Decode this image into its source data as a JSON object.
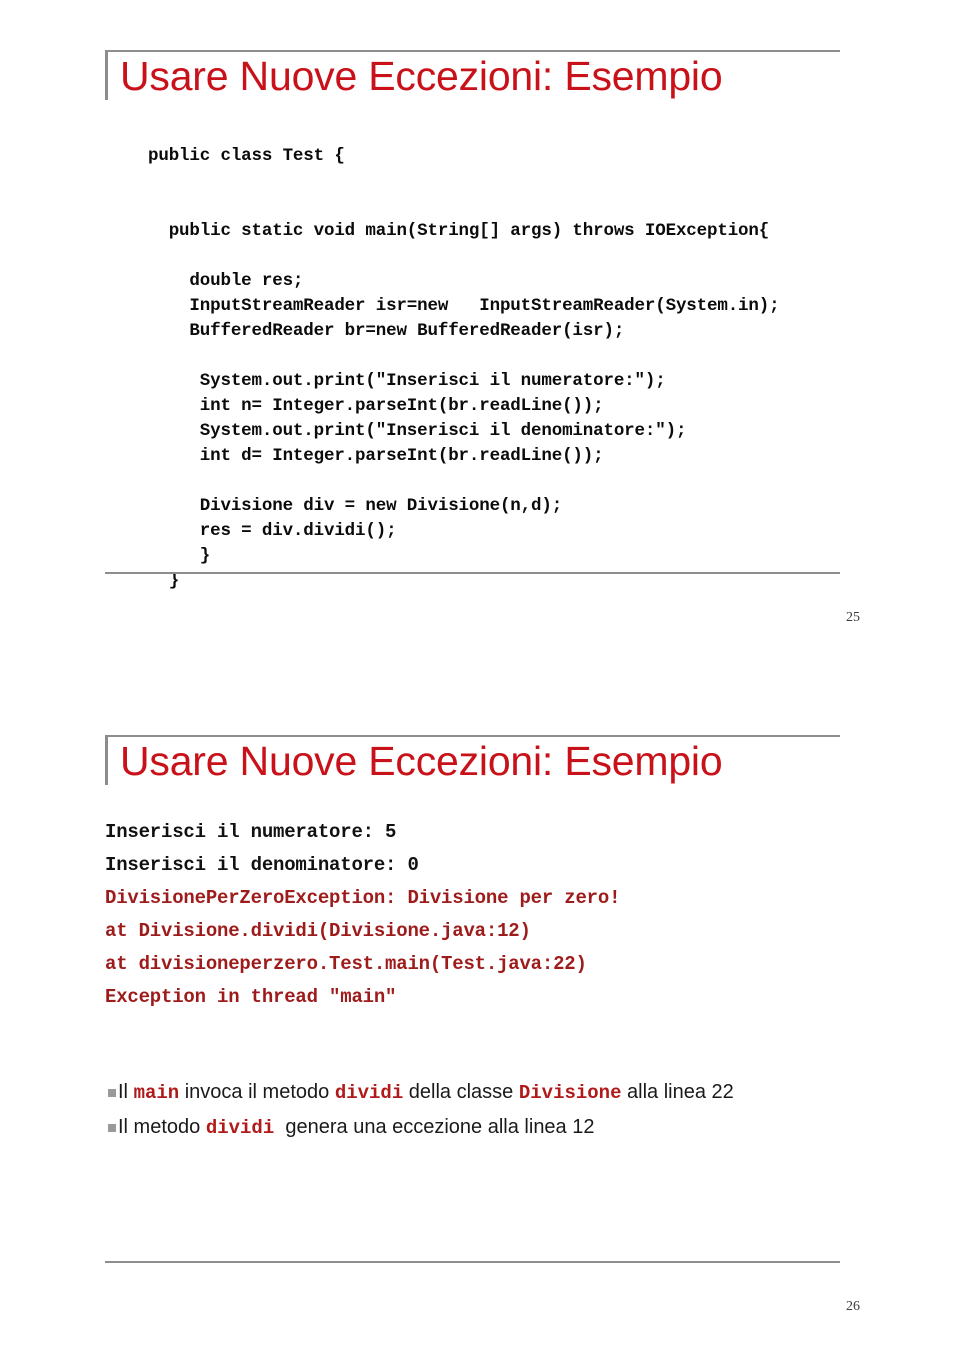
{
  "document": {
    "type": "lecture-slides-handout",
    "page_count_visible": 2
  },
  "colors": {
    "title_red": "#c9111a",
    "exception_red": "#9e1b1b",
    "inline_code_red": "#b01a1a",
    "rule_gray": "#8d8d8d",
    "bullet_gray": "#9a9a9a",
    "code_black": "#0b0b0b"
  },
  "slide1": {
    "title": "Usare Nuove Eccezioni: Esempio",
    "page_number": "25",
    "code_lines": [
      "public class Test {",
      "",
      "",
      "  public static void main(String[] args) throws IOException{",
      "",
      "    double res;",
      "    InputStreamReader isr=new   InputStreamReader(System.in);",
      "    BufferedReader br=new BufferedReader(isr);",
      "",
      "     System.out.print(\"Inserisci il numeratore:\");",
      "     int n= Integer.parseInt(br.readLine());",
      "     System.out.print(\"Inserisci il denominatore:\");",
      "     int d= Integer.parseInt(br.readLine());",
      "",
      "     Divisione div = new Divisione(n,d);",
      "     res = div.dividi();",
      "     }",
      "  }"
    ]
  },
  "slide2": {
    "title": "Usare Nuove Eccezioni: Esempio",
    "page_number": "26",
    "console_lines": [
      {
        "text": "Inserisci il numeratore: 5",
        "style": "io"
      },
      {
        "text": "Inserisci il denominatore: 0",
        "style": "io"
      },
      {
        "text": "DivisionePerZeroException: Divisione per zero!",
        "style": "exc"
      },
      {
        "text": "at Divisione.dividi(Divisione.java:12)",
        "style": "exc"
      },
      {
        "text": "at divisioneperzero.Test.main(Test.java:22)",
        "style": "exc"
      },
      {
        "text": "Exception in thread \"main\"",
        "style": "exc"
      }
    ],
    "bullets": [
      {
        "marker": "square-bullet",
        "parts": [
          {
            "text": "Il ",
            "code": false
          },
          {
            "text": "main",
            "code": true
          },
          {
            "text": " invoca il metodo ",
            "code": false
          },
          {
            "text": "dividi",
            "code": true
          },
          {
            "text": " della classe ",
            "code": false
          },
          {
            "text": "Divisione",
            "code": true
          },
          {
            "text": " alla linea 22",
            "code": false
          }
        ]
      },
      {
        "marker": "square-bullet",
        "parts": [
          {
            "text": "Il metodo ",
            "code": false
          },
          {
            "text": "dividi",
            "code": true
          },
          {
            "text": "  genera una eccezione alla linea 12",
            "code": false
          }
        ]
      }
    ]
  }
}
